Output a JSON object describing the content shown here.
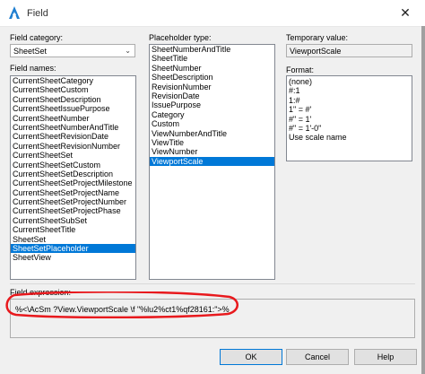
{
  "window": {
    "title": "Field",
    "close_glyph": "✕",
    "accent": "#0078d7",
    "annotation_color": "#e8191d"
  },
  "field_category": {
    "label": "Field category:",
    "value": "SheetSet"
  },
  "field_names": {
    "label": "Field names:",
    "items": [
      "CurrentSheetCategory",
      "CurrentSheetCustom",
      "CurrentSheetDescription",
      "CurrentSheetIssuePurpose",
      "CurrentSheetNumber",
      "CurrentSheetNumberAndTitle",
      "CurrentSheetRevisionDate",
      "CurrentSheetRevisionNumber",
      "CurrentSheetSet",
      "CurrentSheetSetCustom",
      "CurrentSheetSetDescription",
      "CurrentSheetSetProjectMilestone",
      "CurrentSheetSetProjectName",
      "CurrentSheetSetProjectNumber",
      "CurrentSheetSetProjectPhase",
      "CurrentSheetSubSet",
      "CurrentSheetTitle",
      "SheetSet",
      "SheetSetPlaceholder",
      "SheetView"
    ],
    "selected": "SheetSetPlaceholder"
  },
  "placeholder_type": {
    "label": "Placeholder type:",
    "items": [
      "SheetNumberAndTitle",
      "SheetTitle",
      "SheetNumber",
      "SheetDescription",
      "RevisionNumber",
      "RevisionDate",
      "IssuePurpose",
      "Category",
      "Custom",
      "ViewNumberAndTitle",
      "ViewTitle",
      "ViewNumber",
      "ViewportScale"
    ],
    "selected": "ViewportScale"
  },
  "temporary_value": {
    "label": "Temporary value:",
    "value": "ViewportScale"
  },
  "format": {
    "label": "Format:",
    "items": [
      "(none)",
      "#:1",
      "1:#",
      "1\" = #'",
      "#\" = 1'",
      "#\" = 1'-0\"",
      "Use scale name"
    ]
  },
  "field_expression": {
    "label": "Field expression:",
    "value": "%<\\AcSm ?View.ViewportScale \\f \"%lu2%ct1%qf28161:\">%"
  },
  "buttons": {
    "ok": "OK",
    "cancel": "Cancel",
    "help": "Help"
  },
  "icons": {
    "app": "autocad-a-icon",
    "close": "close-icon",
    "dropdown": "chevron-down-icon"
  }
}
